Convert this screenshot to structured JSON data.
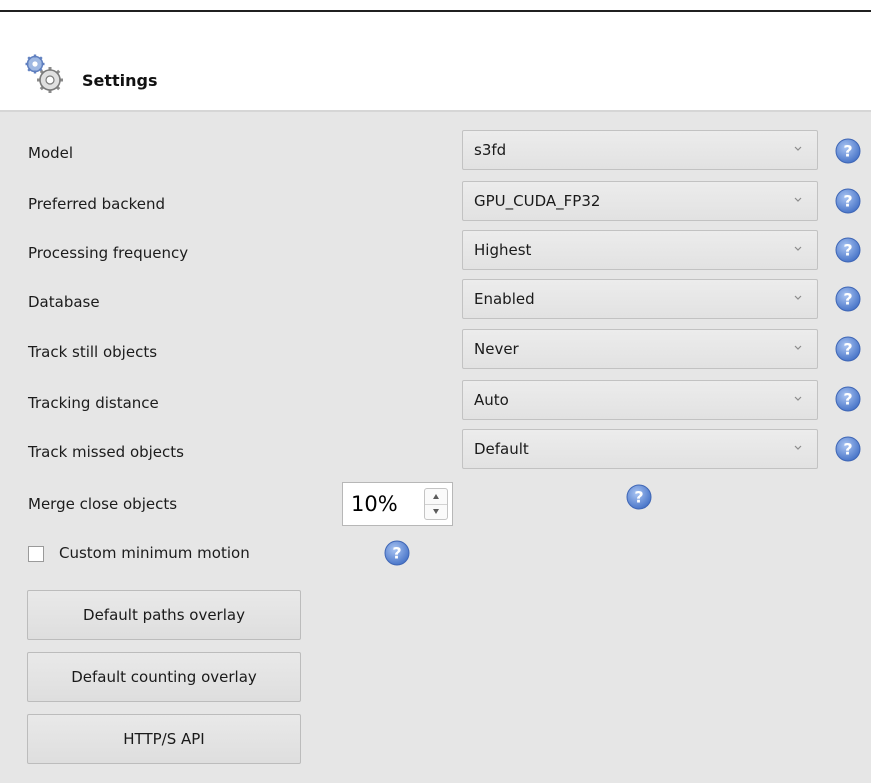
{
  "header": {
    "title": "Settings",
    "icon": "settings-gears-icon"
  },
  "settings": [
    {
      "label": "Model",
      "value": "s3fd"
    },
    {
      "label": "Preferred backend",
      "value": "GPU_CUDA_FP32"
    },
    {
      "label": "Processing frequency",
      "value": "Highest"
    },
    {
      "label": "Database",
      "value": "Enabled"
    },
    {
      "label": "Track still objects",
      "value": "Never"
    },
    {
      "label": "Tracking distance",
      "value": "Auto"
    },
    {
      "label": "Track missed objects",
      "value": "Default"
    }
  ],
  "merge": {
    "label": "Merge close objects",
    "value": "10%"
  },
  "custom_motion": {
    "label": "Custom minimum motion",
    "checked": false
  },
  "buttons": {
    "paths_overlay": "Default paths overlay",
    "counting_overlay": "Default counting overlay",
    "http_api": "HTTP/S API"
  },
  "colors": {
    "panel_bg": "#e6e6e6",
    "help_icon_blue": "#5b86d6"
  }
}
